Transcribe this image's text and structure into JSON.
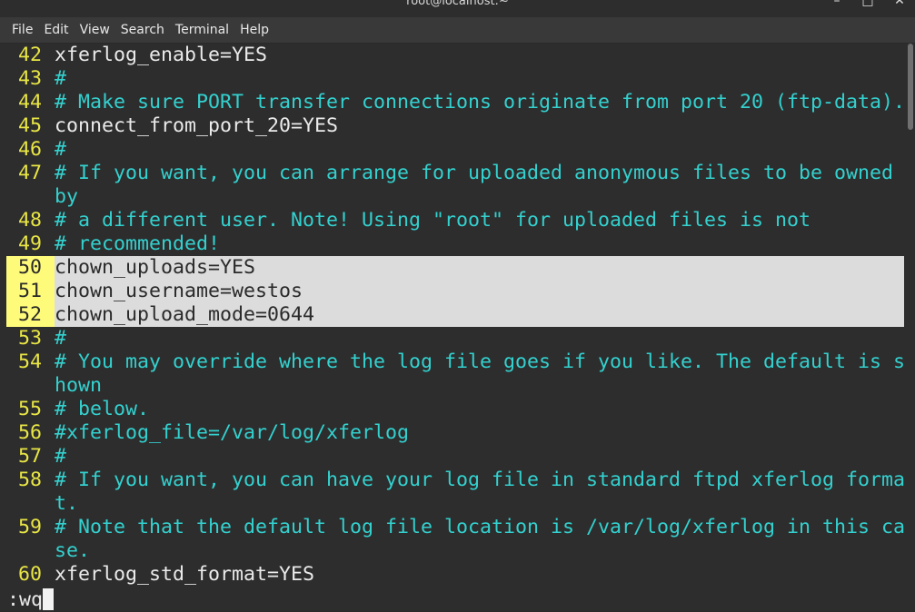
{
  "window": {
    "title": "root@localhost:~",
    "minimize_label": "–",
    "maximize_label": "□",
    "close_label": "✕"
  },
  "menu": [
    "File",
    "Edit",
    "View",
    "Search",
    "Terminal",
    "Help"
  ],
  "lines": [
    {
      "num": "42",
      "text": "xferlog_enable=YES",
      "kind": "plain"
    },
    {
      "num": "43",
      "text": "#",
      "kind": "comment"
    },
    {
      "num": "44",
      "text": "# Make sure PORT transfer connections originate from port 20 (ftp-data).",
      "kind": "comment"
    },
    {
      "num": "45",
      "text": "connect_from_port_20=YES",
      "kind": "plain"
    },
    {
      "num": "46",
      "text": "#",
      "kind": "comment"
    },
    {
      "num": "47",
      "text": "# If you want, you can arrange for uploaded anonymous files to be owned",
      "kind": "comment",
      "wrap": "by"
    },
    {
      "num": "48",
      "text": "# a different user. Note! Using \"root\" for uploaded files is not",
      "kind": "comment"
    },
    {
      "num": "49",
      "text": "# recommended!",
      "kind": "comment"
    },
    {
      "num": "50",
      "text": "chown_uploads=YES",
      "kind": "plain",
      "selected": true
    },
    {
      "num": "51",
      "text": "chown_username=westos",
      "kind": "plain",
      "selected": true
    },
    {
      "num": "52",
      "text": "chown_upload_mode=0644",
      "kind": "plain",
      "selected": true
    },
    {
      "num": "53",
      "text": "#",
      "kind": "comment"
    },
    {
      "num": "54",
      "text": "# You may override where the log file goes if you like. The default is s",
      "kind": "comment",
      "wrap": "hown"
    },
    {
      "num": "55",
      "text": "# below.",
      "kind": "comment"
    },
    {
      "num": "56",
      "text": "#xferlog_file=/var/log/xferlog",
      "kind": "comment"
    },
    {
      "num": "57",
      "text": "#",
      "kind": "comment"
    },
    {
      "num": "58",
      "text": "# If you want, you can have your log file in standard ftpd xferlog forma",
      "kind": "comment",
      "wrap": "t."
    },
    {
      "num": "59",
      "text": "# Note that the default log file location is /var/log/xferlog in this ca",
      "kind": "comment",
      "wrap": "se."
    },
    {
      "num": "60",
      "text": "xferlog_std_format=YES",
      "kind": "plain"
    }
  ],
  "command_line": ":wq",
  "colors": {
    "comment": "#33d1cf",
    "line_number": "#e8e545",
    "selection": "#dcdcdc",
    "background": "#2d2d2d"
  }
}
